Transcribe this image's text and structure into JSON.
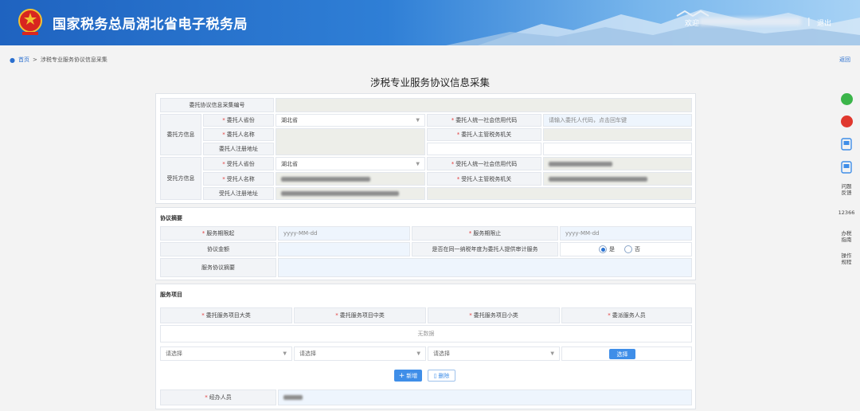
{
  "header": {
    "title": "国家税务总局湖北省电子税务局",
    "welcome": "欢迎",
    "logout": "退出",
    "separator": "|"
  },
  "breadcrumb": {
    "home": "首页",
    "arrow": ">",
    "current": "涉税专业服务协议信息采集"
  },
  "back_label": "返回",
  "page_title": "涉税专业服务协议信息采集",
  "rail": {
    "feedback": "问题反馈",
    "hotline": "12366",
    "guide": "办税指南",
    "process": "操作规程"
  },
  "section1": {
    "agreement_no_label": "委托协议信息采集编号",
    "client_group": "委托方信息",
    "client_region_label": "委托人省份",
    "client_region_value": "湖北省",
    "client_name_label": "委托人名称",
    "client_addr_label": "委托人注册地址",
    "client_credit_label": "委托人统一社会信用代码",
    "client_credit_placeholder": "请输入委托人代码，点击回车键",
    "client_tax_label": "委托人主管税务机关",
    "agent_group": "受托方信息",
    "agent_region_label": "受托人省份",
    "agent_region_value": "湖北省",
    "agent_name_label": "受托人名称",
    "agent_addr_label": "受托人注册地址",
    "agent_credit_label": "受托人统一社会信用代码",
    "agent_tax_label": "受托人主管税务机关"
  },
  "section2": {
    "title": "协议摘要",
    "start_label": "服务期限起",
    "start_placeholder": "yyyy-MM-dd",
    "end_label": "服务期限止",
    "end_placeholder": "yyyy-MM-dd",
    "amount_label": "协议金额",
    "audit_label": "是否在同一纳税年度为委托人提供审计服务",
    "yes": "是",
    "no": "否",
    "summary_label": "服务协议摘要"
  },
  "section3": {
    "title": "服务项目",
    "columns": [
      "委托服务项目大类",
      "委托服务项目中类",
      "委托服务项目小类",
      "委派服务人员"
    ],
    "empty": "无数据",
    "select_placeholder": "请选择",
    "pick_button": "选择",
    "add_button": "新增",
    "delete_button": "删除",
    "handler_label": "经办人员"
  }
}
